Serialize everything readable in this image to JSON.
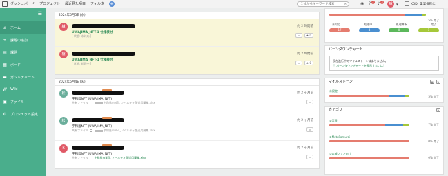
{
  "colors": {
    "sidebar": "#4aae8c",
    "accent_green": "#2e8b57",
    "bar_open": "#e57c6f",
    "bar_in_progress": "#4a8fd0",
    "bar_resolved": "#5cb85c",
    "bar_done": "#a6c83a",
    "highlight": "#f9f6d8"
  },
  "topbar": {
    "nav": [
      "ダッシュボード",
      "プロジェクト",
      "最近見た項目",
      "フィルタ"
    ],
    "plus": "+",
    "search_placeholder": "全体からキーワード検索",
    "help_badge": "2",
    "notif_badge": "3",
    "avatar": "櫨",
    "space": "KODI_業業推進に"
  },
  "sidebar": {
    "collapse_icon": "☰",
    "items": [
      {
        "icon": "⌂",
        "label": "ホーム"
      },
      {
        "icon": "+",
        "label": "課題の追加"
      },
      {
        "icon": "▤",
        "label": "課題"
      },
      {
        "icon": "▦",
        "label": "ボード"
      },
      {
        "icon": "▬",
        "label": "ガントチャート"
      },
      {
        "icon": "W",
        "label": "Wiki"
      },
      {
        "icon": "▣",
        "label": "ファイル"
      },
      {
        "icon": "⚙",
        "label": "プロジェクト設定"
      }
    ]
  },
  "feed": [
    {
      "date": "2024年6月5日(水)",
      "entries": [
        {
          "avatar": "櫨",
          "avatar_color": "#e05a67",
          "title": "UWAJIMA_NFT-1 仕様検討",
          "sub": "[ 状態: 未対応 ]",
          "time": "約 2 時間前",
          "comment": "▭",
          "star": "★ 0"
        },
        {
          "avatar": "櫨",
          "avatar_color": "#e05a67",
          "title": "UWAJIMA_NFT-1 仕様検討",
          "sub": "[ 状態: 処理中 ]",
          "time": "約 2 時間前",
          "comment": "▭",
          "star": "★ 0"
        }
      ]
    },
    {
      "date": "2024年6月4日(火)",
      "entries": [
        {
          "avatar": "松",
          "avatar_color": "#6aae9b",
          "title": "宇和島NFT (UWAJIMA_NFT)",
          "file_label": "共有ファイル",
          "file_path": "宇和島市NEL_ノベルティ酸送用蘭集.xlsx",
          "time": "約 2 ヶ月前",
          "comment": "▭"
        },
        {
          "avatar": "松",
          "avatar_color": "#6aae9b",
          "title": "宇和島NFT (UWAJIMA_NFT)",
          "file_label": "共有ファイル",
          "file_path": "宇和島市NEL_ノベルティ酸送用蘭集.xlsx",
          "time": "約 2 ヶ月前",
          "comment": "▭"
        },
        {
          "avatar": "K",
          "avatar_color": "#e05a67",
          "title": "宇和島NFT (UWAJIMA_NFT)",
          "file_label": "共有ファイル",
          "file_path": "宇和島市NEL_ノベルティ酸送用蘭集.xlsx",
          "time": "約 2 ヶ月前",
          "comment": "▭"
        }
      ]
    }
  ],
  "right": {
    "status": {
      "percent": "5% 完了",
      "labels": [
        "未対応",
        "処理中",
        "処理済み",
        "完了"
      ],
      "counts": [
        "17",
        "4",
        "0",
        "1"
      ],
      "pill_colors": [
        "#e57c6f",
        "#4a8fd0",
        "#5cb85c",
        "#a6c83a"
      ]
    },
    "burndown": {
      "title": "バーンダウンチャート",
      "message": "現在進行中のマイルストーンはありません。",
      "link": "バーンダウンチャートを表示するには？"
    },
    "milestone": {
      "title": "マイルストーン",
      "item": "未設定",
      "percent": "5% 完了",
      "open_pct": 0.75,
      "progress_pct": 0.2,
      "done_pct": 0.05
    },
    "category": {
      "title": "カテゴリー",
      "items": [
        {
          "label": "①実遠",
          "percent": "7% 完了",
          "open_pct": 0.7,
          "progress_pct": 0.22,
          "done_pct": 0.08
        },
        {
          "label": "②MetaSamurai",
          "percent": "0% 完了",
          "open_pct": 1.0,
          "progress_pct": 0,
          "done_pct": 0
        },
        {
          "label": "③店城ファン向け",
          "percent": "0% 完了",
          "open_pct": 1.0,
          "progress_pct": 0,
          "done_pct": 0
        }
      ]
    }
  }
}
